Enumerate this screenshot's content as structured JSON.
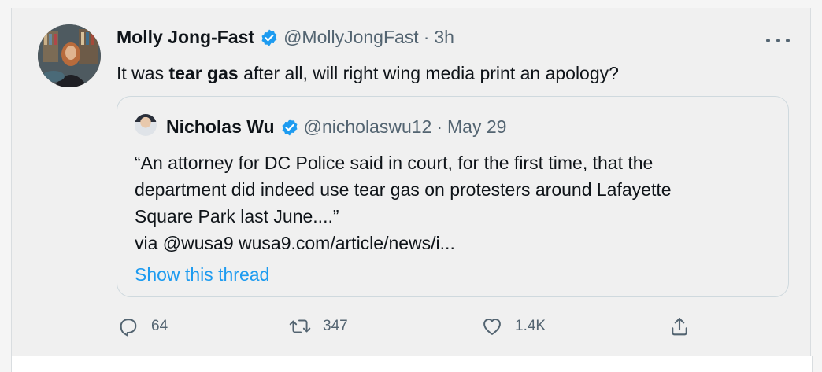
{
  "tweet": {
    "author_name": "Molly Jong-Fast",
    "author_handle": "@MollyJongFast",
    "separator": "·",
    "time": "3h",
    "text_before": "It was ",
    "text_bold": "tear gas",
    "text_after": " after all, will right wing media print an apology?"
  },
  "quote": {
    "author_name": "Nicholas Wu",
    "author_handle": "@nicholaswu12",
    "separator": "·",
    "date": "May 29",
    "lines": [
      "“An attorney for DC Police said in court, for the first time, that the",
      "department did indeed use tear gas on protesters around Lafayette",
      "Square Park last June....”",
      "via @wusa9  wusa9.com/article/news/i..."
    ],
    "show_thread": "Show this thread"
  },
  "actions": {
    "replies": "64",
    "retweets": "347",
    "likes": "1.4K"
  },
  "icons": {
    "verified": "verified-badge-icon",
    "more": "more-horizontal-icon",
    "reply": "reply-icon",
    "retweet": "retweet-icon",
    "like": "heart-icon",
    "share": "share-icon"
  },
  "colors": {
    "accent": "#1d9bf0",
    "muted": "#536471",
    "text": "#0f1419",
    "background": "#f0f0f0"
  }
}
